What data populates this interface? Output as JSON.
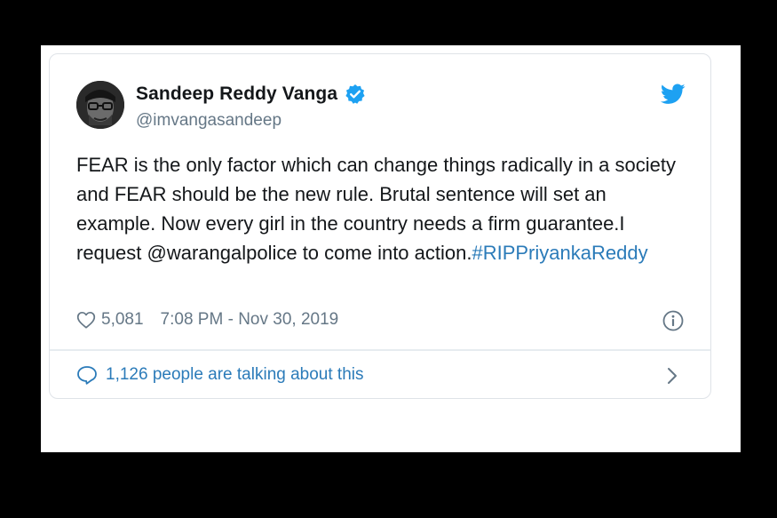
{
  "tweet": {
    "author": {
      "display_name": "Sandeep Reddy Vanga",
      "handle": "@imvangasandeep",
      "verified": true
    },
    "text_before_hashtag": "FEAR is the only factor which can change things radically in a society and FEAR should be the new rule. Brutal sentence will set an example. Now every girl in the country needs a firm guarantee.I request @warangalpolice to come into action.",
    "hashtag": "#RIPPriyankaReddy",
    "likes": "5,081",
    "timestamp": "7:08 PM - Nov 30, 2019",
    "conversation": "1,126 people are talking about this"
  },
  "icons": {
    "verified": "verified-badge-icon",
    "brand": "twitter-bird-icon",
    "like": "heart-icon",
    "info": "info-icon",
    "reply": "speech-bubble-icon",
    "more": "chevron-right-icon"
  },
  "colors": {
    "background": "#000000",
    "card": "#ffffff",
    "text": "#14171a",
    "secondary_text": "#657786",
    "link": "#2b7bb9",
    "twitter_blue": "#1da1f2"
  }
}
